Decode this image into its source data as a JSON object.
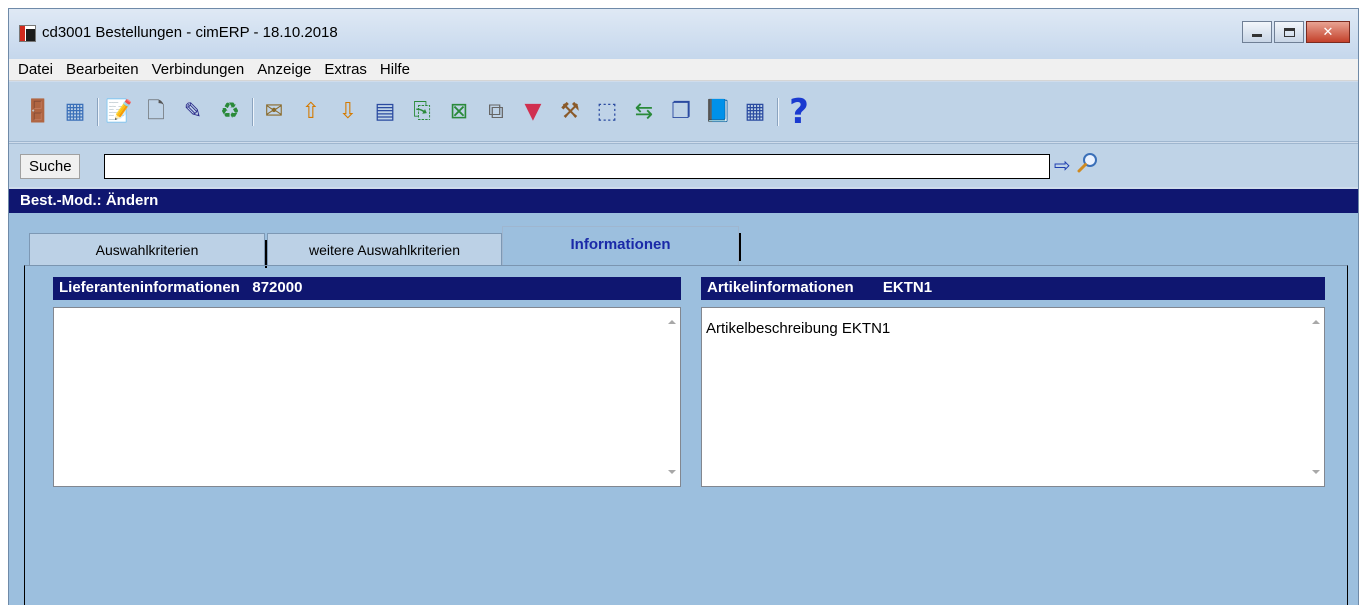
{
  "window": {
    "title": "cd3001 Bestellungen - cimERP - 18.10.2018",
    "close_glyph": "✕"
  },
  "menu": [
    "Datei",
    "Bearbeiten",
    "Verbindungen",
    "Anzeige",
    "Extras",
    "Hilfe"
  ],
  "toolbar": {
    "groups": [
      [
        {
          "name": "exit-icon",
          "glyph": "🚪",
          "color": "#2f7a3c"
        },
        {
          "name": "calendar-form-icon",
          "glyph": "▦",
          "color": "#3a6fb8"
        }
      ],
      [
        {
          "name": "edit-form-icon",
          "glyph": "📝",
          "color": "#6a6aa0"
        },
        {
          "name": "new-document-icon",
          "glyph": "🗋",
          "color": "#555"
        },
        {
          "name": "pencil-edit-icon",
          "glyph": "✎",
          "color": "#2a2a8a"
        },
        {
          "name": "refresh-icon",
          "glyph": "♻",
          "color": "#2a8a3a"
        }
      ],
      [
        {
          "name": "mail-icon",
          "glyph": "✉",
          "color": "#8a6a2a"
        },
        {
          "name": "sort-ascending-icon",
          "glyph": "⇧",
          "color": "#d47a00"
        },
        {
          "name": "sort-descending-icon",
          "glyph": "⇩",
          "color": "#d47a00"
        },
        {
          "name": "numbered-list-icon",
          "glyph": "▤",
          "color": "#2a4aa0"
        },
        {
          "name": "export-icon",
          "glyph": "⎘",
          "color": "#2a8a3a"
        },
        {
          "name": "excel-icon",
          "glyph": "⊠",
          "color": "#2a8a3a"
        },
        {
          "name": "copy-icon",
          "glyph": "⧉",
          "color": "#666"
        },
        {
          "name": "filter-icon",
          "glyph": "▼",
          "color": "#d03050"
        },
        {
          "name": "wizard-icon",
          "glyph": "⚒",
          "color": "#8a5a2a"
        },
        {
          "name": "select-region-icon",
          "glyph": "⬚",
          "color": "#2a4aa0"
        },
        {
          "name": "transfer-icon",
          "glyph": "⇆",
          "color": "#2a8a3a"
        },
        {
          "name": "windows-icon",
          "glyph": "❐",
          "color": "#2a4aa0"
        },
        {
          "name": "book-icon",
          "glyph": "📘",
          "color": "#2a8a9a"
        },
        {
          "name": "grid-icon",
          "glyph": "▦",
          "color": "#2a4aa0"
        }
      ],
      [
        {
          "name": "help-icon",
          "glyph": "?",
          "color": "#1a3ad0"
        }
      ]
    ]
  },
  "search": {
    "label": "Suche",
    "value": "",
    "go_glyph": "⇨"
  },
  "mode_bar": {
    "text": "Best.-Mod.: Ändern"
  },
  "tabs": [
    {
      "label": "Auswahlkriterien",
      "active": false
    },
    {
      "label": "weitere Auswahlkriterien",
      "active": false
    },
    {
      "label": "Informationen",
      "active": true
    }
  ],
  "supplier_panel": {
    "title": "Lieferanteninformationen",
    "id": "872000",
    "text": ""
  },
  "article_panel": {
    "title": "Artikelinformationen",
    "id": "EKTN1",
    "text": "Artikelbeschreibung EKTN1"
  }
}
